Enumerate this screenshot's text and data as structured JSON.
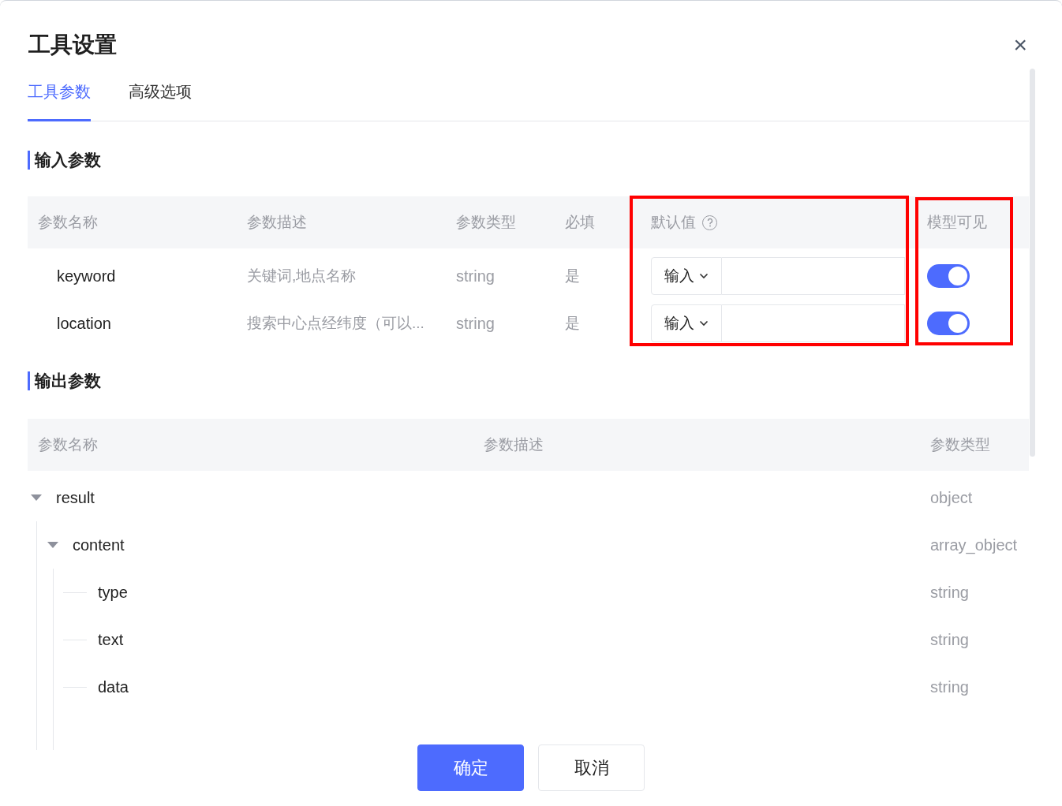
{
  "dialog": {
    "title": "工具设置",
    "close": "×"
  },
  "tabs": [
    {
      "label": "工具参数",
      "selected": true
    },
    {
      "label": "高级选项",
      "selected": false
    }
  ],
  "input_section": {
    "title": "输入参数",
    "columns": [
      "参数名称",
      "参数描述",
      "参数类型",
      "必填",
      "默认值",
      "模型可见"
    ],
    "rows": [
      {
        "name": "keyword",
        "description": "关键词,地点名称",
        "type": "string",
        "required": "是",
        "source": "输入",
        "visible": true
      },
      {
        "name": "location",
        "description": "搜索中心点经纬度（可以...",
        "type": "string",
        "required": "是",
        "source": "输入",
        "visible": true
      }
    ]
  },
  "output_section": {
    "title": "输出参数",
    "columns": [
      "参数名称",
      "参数描述",
      "参数类型"
    ],
    "tree": [
      {
        "name": "result",
        "type": "object",
        "expanded": true,
        "children": [
          {
            "name": "content",
            "type": "array_object",
            "expanded": true,
            "children": [
              {
                "name": "type",
                "type": "string"
              },
              {
                "name": "text",
                "type": "string"
              },
              {
                "name": "data",
                "type": "string"
              }
            ]
          }
        ]
      }
    ]
  },
  "buttons": [
    {
      "label": "确定",
      "kind": "primary"
    },
    {
      "label": "取消",
      "kind": "secondary"
    }
  ]
}
